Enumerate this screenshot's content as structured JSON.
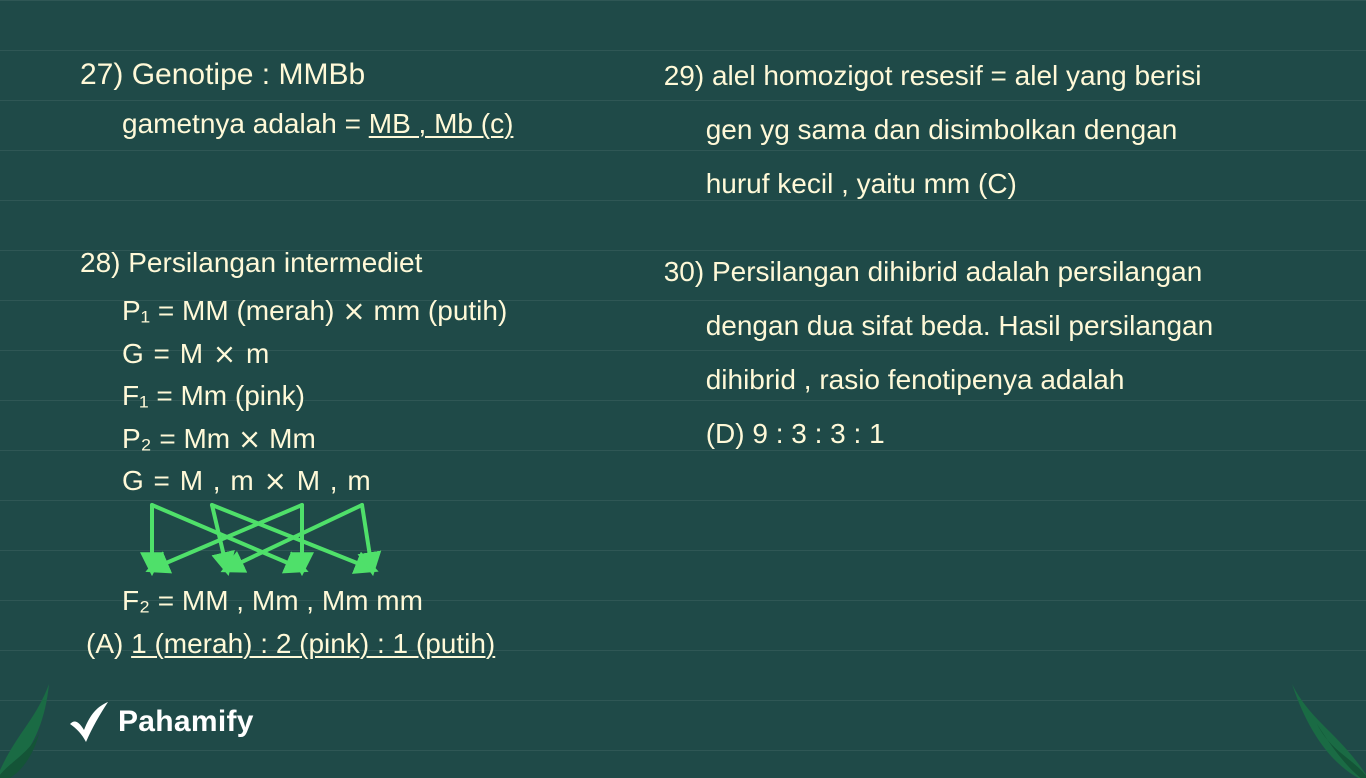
{
  "brand": {
    "name": "Pahamify"
  },
  "left": {
    "q27": {
      "line1": "27) Genotipe : MMBb",
      "line2_pre": "gametnya adalah = ",
      "line2_ul": "MB , Mb (c)"
    },
    "q28": {
      "title": "28) Persilangan intermediet",
      "p1": "P₁ = MM (merah)  ⨯  mm (putih)",
      "g1": "G = M          ⨯ m",
      "f1": "F₁ =  Mm  (pink)",
      "p2": "P₂ =  Mm  ⨯  Mm",
      "g2": "G = M , m    ⨯   M ,  m",
      "f2": "F₂ = MM ,   Mm  ,   Mm    mm",
      "ans_pre": "(A)  ",
      "ans_ul": "1 (merah) : 2 (pink) : 1  (putih)"
    }
  },
  "right": {
    "q29": {
      "l1": "29) alel  homozigot  resesif  =  alel  yang  berisi",
      "l2": "gen  yg  sama  dan  disimbolkan  dengan",
      "l3": "huruf  kecil ,   yaitu     mm  (C)"
    },
    "q30": {
      "l1": "30) Persilangan  dihibrid  adalah  persilangan",
      "l2": "dengan  dua  sifat  beda.  Hasil  persilangan",
      "l3": "dihibrid ,  rasio  fenotipenya  adalah",
      "l4": "(D)   9 : 3 : 3 : 1"
    }
  }
}
